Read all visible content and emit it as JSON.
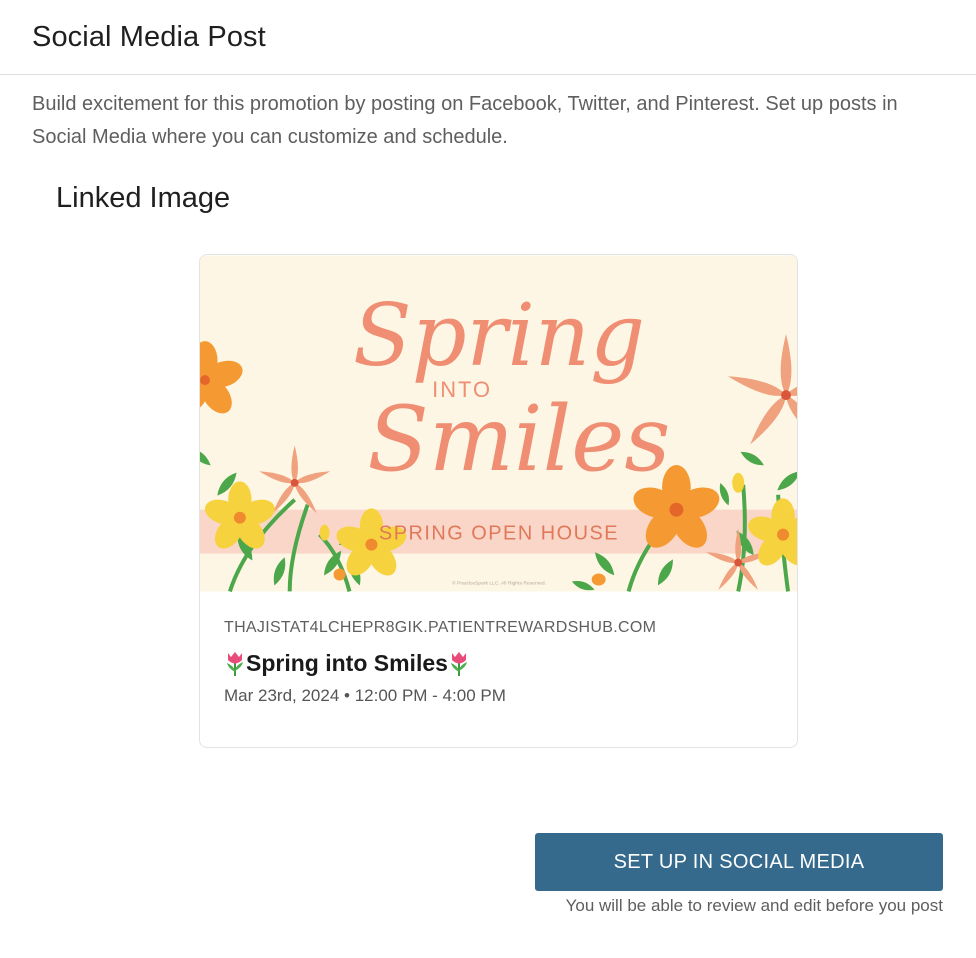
{
  "header": {
    "title": "Social Media Post"
  },
  "description": "Build excitement for this promotion by posting on Facebook, Twitter, and Pinterest. Set up posts in Social Media where you can customize and schedule.",
  "linked_image": {
    "section_title": "Linked Image",
    "banner": {
      "headline_top": "Spring",
      "headline_into": "INTO",
      "headline_bottom": "Smiles",
      "ribbon_text": "SPRING OPEN HOUSE",
      "copyright": "© PracticeSpark LLC. All Rights Reserved."
    },
    "domain": "THAJISTAT4LCHEPR8GIK.PATIENTREWARDSHUB.COM",
    "title": "Spring into Smiles",
    "title_icon": "tulip-icon",
    "date": "Mar 23rd, 2024 • 12:00 PM - 4:00 PM"
  },
  "actions": {
    "setup_button_label": "SET UP IN SOCIAL MEDIA",
    "note": "You will be able to review and edit before you post"
  },
  "colors": {
    "primary_button": "#356a8d",
    "banner_background": "#fdf6e4",
    "headline": "#ef8e72",
    "ribbon": "#f9d6c8"
  }
}
